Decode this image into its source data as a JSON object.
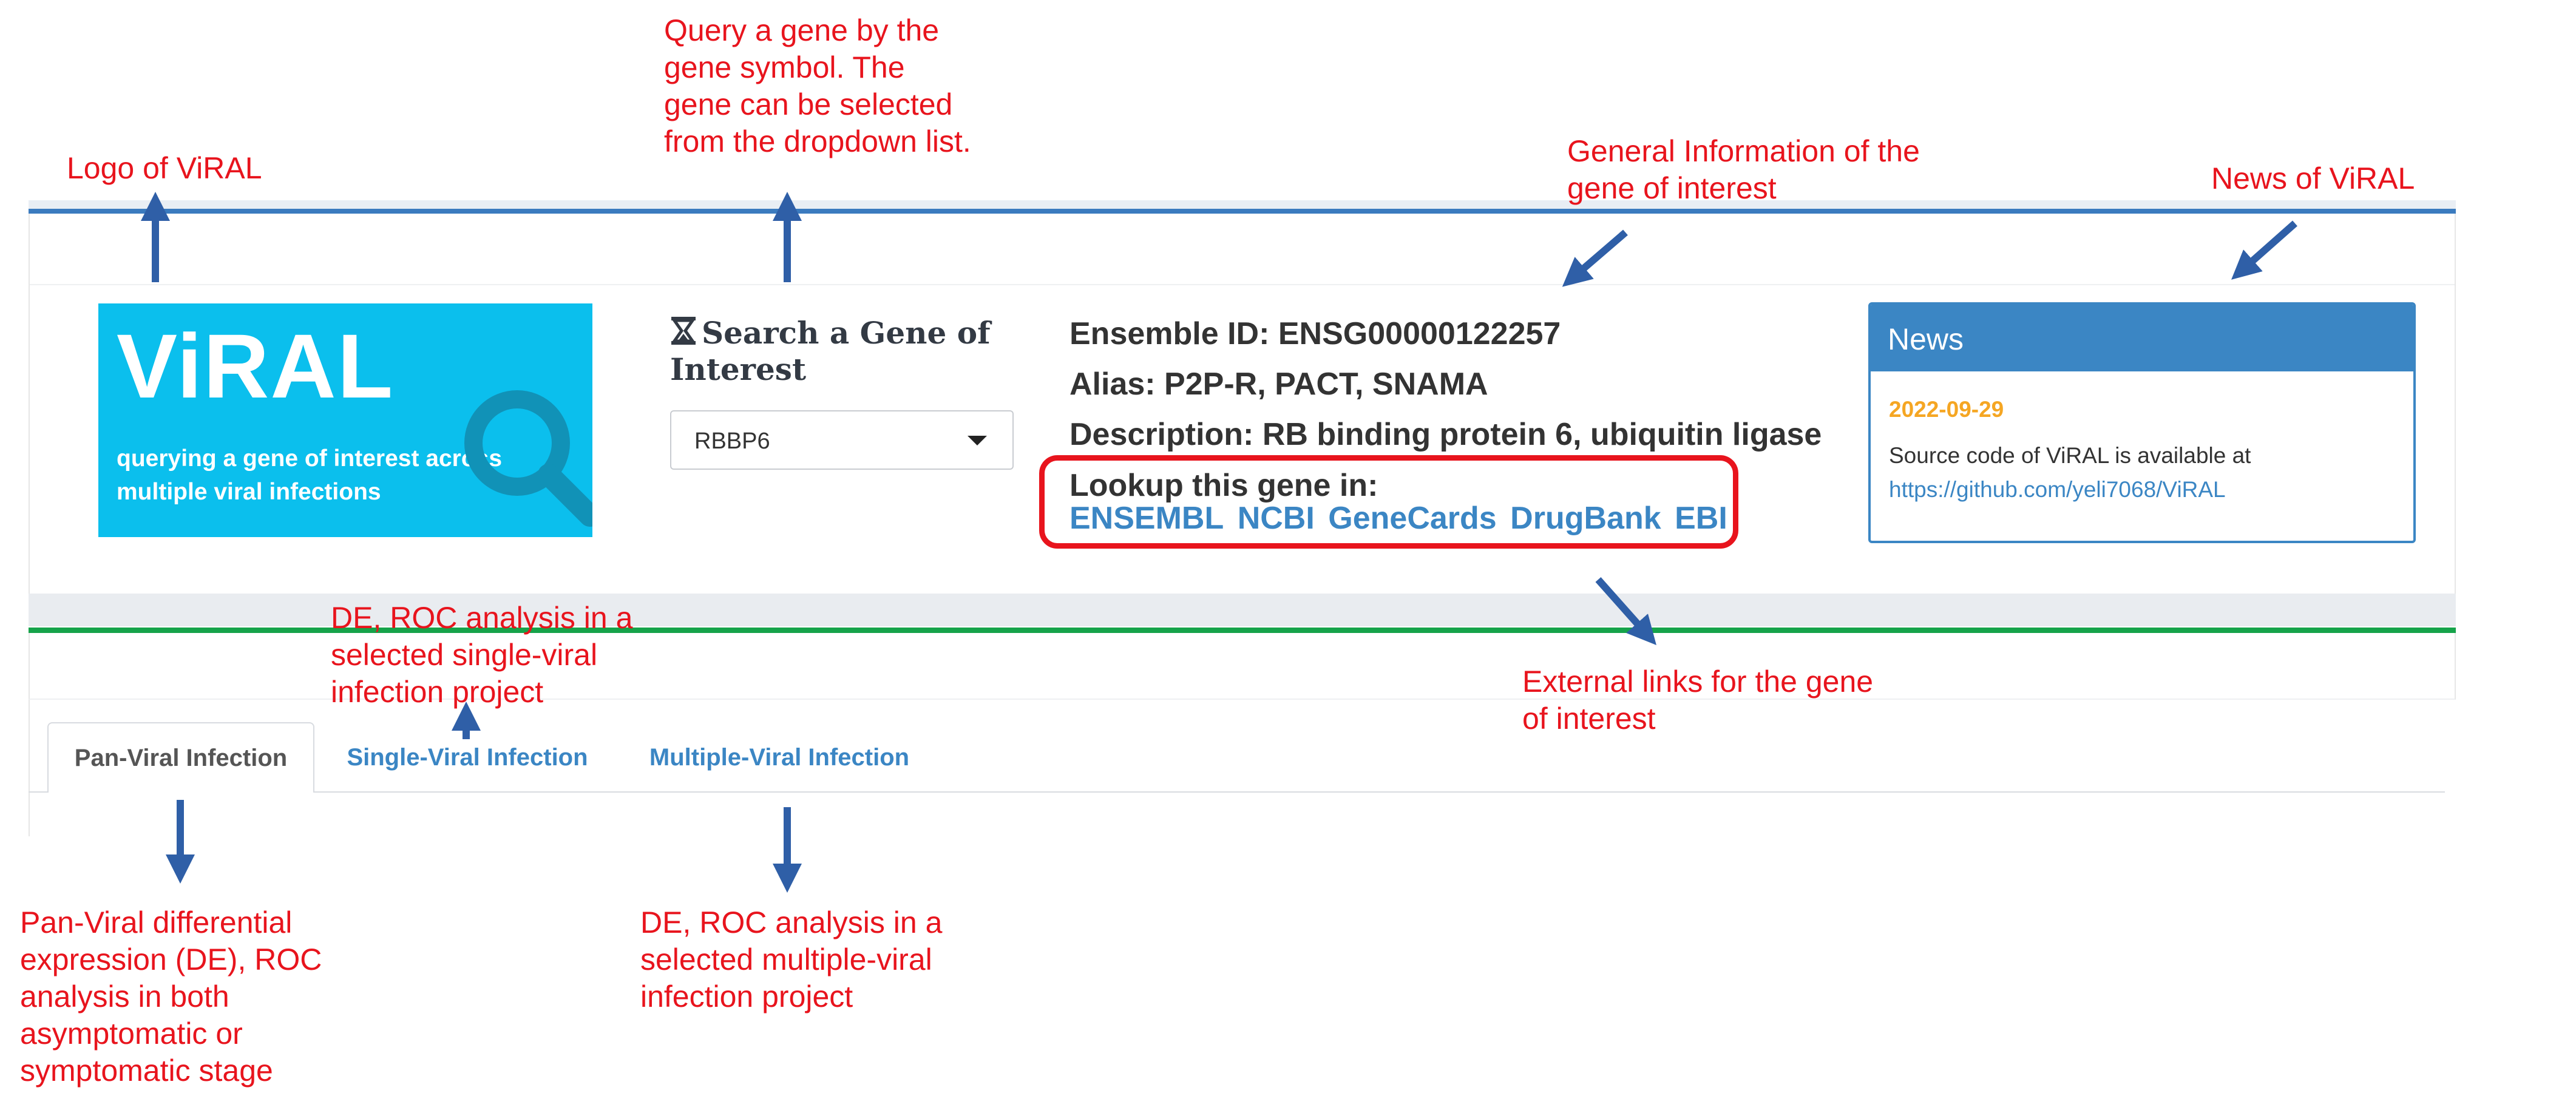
{
  "logo": {
    "title": "ViRAL",
    "subtitle": "querying a gene of interest across multiple viral infections",
    "icon": "magnifier-icon",
    "bg_color": "#0bbfed"
  },
  "search": {
    "icon": "hourglass-icon",
    "title": "Search a Gene of Interest",
    "selected_gene": "RBBP6"
  },
  "gene_info": {
    "ensemble": "Ensemble ID: ENSG00000122257",
    "alias": "Alias: P2P-R, PACT, SNAMA",
    "description": "Description: RB binding protein 6, ubiquitin ligase",
    "lookup_label": "Lookup this gene in:",
    "links": [
      "ENSEMBL",
      "NCBI",
      "GeneCards",
      "DrugBank",
      "EBI"
    ]
  },
  "news": {
    "title": "News",
    "date": "2022-09-29",
    "text": "Source code of ViRAL is available at",
    "link": "https://github.com/yeli7068/ViRAL"
  },
  "tabs": [
    {
      "label": "Pan-Viral Infection",
      "active": true
    },
    {
      "label": "Single-Viral Infection",
      "active": false
    },
    {
      "label": "Multiple-Viral Infection",
      "active": false
    }
  ],
  "annotations": {
    "logo": [
      "Logo of ViRAL"
    ],
    "query": [
      "Query a gene by the",
      "gene symbol. The",
      "gene can be selected",
      "from the dropdown list."
    ],
    "general_info": [
      "General Information of the",
      "gene of interest"
    ],
    "news": [
      "News of ViRAL"
    ],
    "single": [
      "DE, ROC analysis in a",
      "selected single-viral",
      "infection project"
    ],
    "external": [
      "External links for the gene",
      "of interest"
    ],
    "pan": [
      "Pan-Viral differential",
      "expression (DE),  ROC",
      "analysis in both",
      "asymptomatic or",
      "symptomatic stage"
    ],
    "multiple": [
      "DE, ROC analysis in a",
      "selected multiple-viral",
      "infection project"
    ]
  },
  "colors": {
    "annotation": "#e8141d",
    "arrow": "#2f5fa7",
    "accent_blue": "#3b86c4",
    "green_bar": "#16a34a",
    "date": "#f5a623"
  }
}
